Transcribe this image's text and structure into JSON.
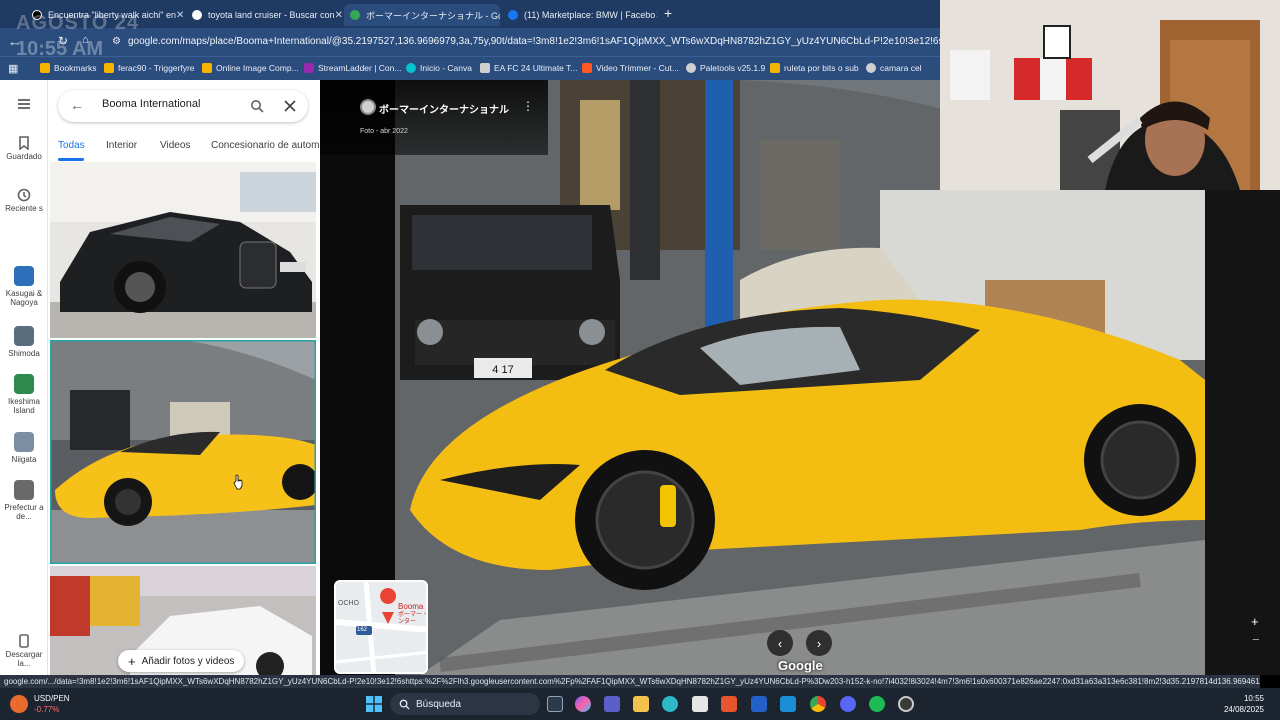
{
  "browser": {
    "tabs": [
      {
        "title": "Encuentra \"liberty walk aichi\" en",
        "favicon_color": "#000000",
        "active": false
      },
      {
        "title": "toyota land cruiser - Buscar con",
        "favicon_color": "#4285F4",
        "active": false
      },
      {
        "title": "ボーマーインターナショナル - Google",
        "favicon_color": "#34A853",
        "active": true
      },
      {
        "title": "(11) Marketplace: BMW | Facebo",
        "favicon_color": "#1877F2",
        "active": false
      }
    ],
    "new_tab_label": "+",
    "url": "google.com/maps/place/Booma+International/@35.2197527,136.9696979,3a,75y,90t/data=!3m8!1e2!3m6!1sAF1QipMXX_WTs6wXDqHN8782hZ1GY_yUz4YUN6CbLd-P!2e10!3e12!6shttps:%2F%2Flh",
    "bookmarks": [
      {
        "label": "Bookmarks",
        "color": "#f4b400"
      },
      {
        "label": "ferac90 - Triggerfyre",
        "color": "#f4b400"
      },
      {
        "label": "Online Image Comp...",
        "color": "#f4b400"
      },
      {
        "label": "StreamLadder | Con...",
        "color": "#9c27b0"
      },
      {
        "label": "Inicio - Canva",
        "color": "#00c4cc"
      },
      {
        "label": "EA FC 24 Ultimate T...",
        "color": "#cfcfcf"
      },
      {
        "label": "Video Trimmer - Cut...",
        "color": "#ff5722"
      },
      {
        "label": "Paletools v25.1.9",
        "color": "#cfcfcf"
      },
      {
        "label": "ruleta por bits o sub",
        "color": "#f4b400"
      },
      {
        "label": "camara cel",
        "color": "#cfcfcf"
      }
    ]
  },
  "overlay": {
    "date": "AGOSTO 24",
    "time": "10:55 AM"
  },
  "maps": {
    "rail": [
      {
        "label": "Guardado",
        "icon": "bookmark-icon"
      },
      {
        "label": "Reciente s",
        "icon": "history-icon"
      },
      {
        "label": "Kasugai & Nagoya",
        "thumb_color": "#2d6fb8"
      },
      {
        "label": "Shimoda",
        "thumb_color": "#5a6d7e"
      },
      {
        "label": "Ikeshima Island",
        "thumb_color": "#2b8a4c"
      },
      {
        "label": "Niigata",
        "thumb_color": "#7d8fa4"
      },
      {
        "label": "Prefectur a de...",
        "thumb_color": "#6a6a6a"
      },
      {
        "label": "Descargar la...",
        "icon": "phone-icon"
      }
    ],
    "search_value": "Booma International",
    "categories": [
      "Todas",
      "Interior",
      "Videos",
      "Concesionario de autom"
    ],
    "active_category": "Todas",
    "add_photos_label": "Añadir fotos y videos",
    "place_name": "ボーマーインターナショナル",
    "photo_date": "Foto - abr 2022",
    "google_label": "Google",
    "minimap_labels": {
      "place": "Booma",
      "place_jp": "ボーマー インター",
      "left": "OCHO",
      "road": "162"
    },
    "plate_number": "4 17"
  },
  "status_url": "google.com/.../data=!3m8!1e2!3m6!1sAF1QipMXX_WTs6wXDqHN8782hZ1GY_yUz4YUN6CbLd-P!2e10!3e12!6shttps:%2F%2Flh3.googleusercontent.com%2Fp%2FAF1QipMXX_WTs6wXDqHN8782hZ1GY_yUz4YUN6CbLd-P%3Dw203-h152-k-no!7i4032!8i3024!4m7!3m6!1s0x600371e826ae2247:0xd31a63a313e6c381!8m2!3d35.2197814d136.9694611!16s",
  "taskbar": {
    "ticker_name": "USD/PEN",
    "ticker_change": "-0.77%",
    "search_label": "Búsqueda",
    "time": "10:55",
    "date": "24/08/2025"
  }
}
